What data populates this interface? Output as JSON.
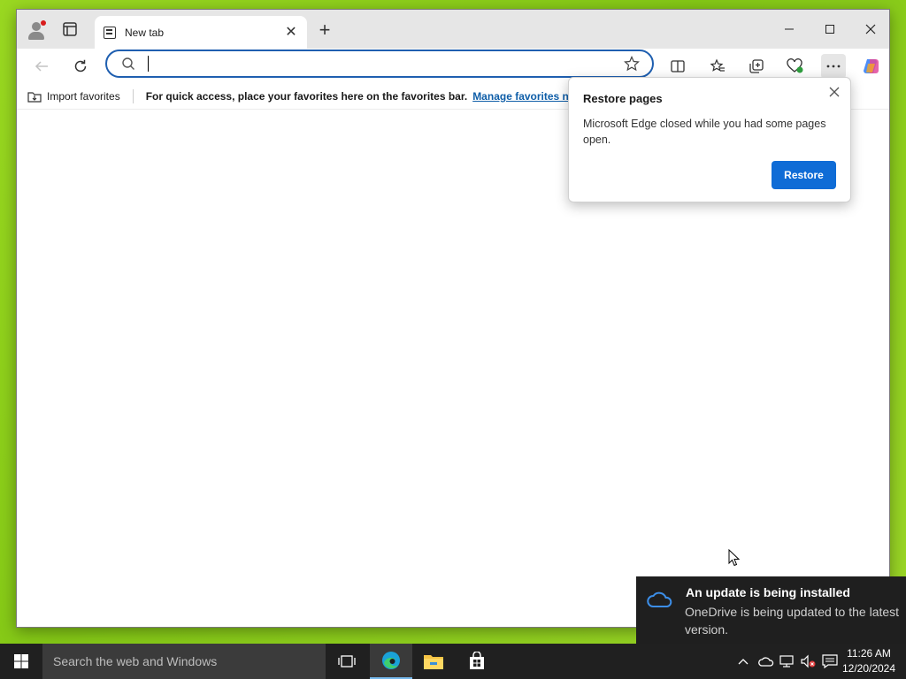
{
  "browser": {
    "tab": {
      "title": "New tab",
      "close_glyph": "✕"
    },
    "new_tab_glyph": "+",
    "address": {
      "value": "",
      "placeholder": ""
    },
    "favorites_bar": {
      "import_label": "Import favorites",
      "message": "For quick access, place your favorites here on the favorites bar.",
      "manage_link": "Manage favorites now"
    }
  },
  "popup": {
    "title": "Restore pages",
    "body": "Microsoft Edge closed while you had some pages open.",
    "button": "Restore"
  },
  "toast": {
    "title": "An update is being installed",
    "body": "OneDrive is being updated to the latest version."
  },
  "taskbar": {
    "search_placeholder": "Search the web and Windows",
    "time": "11:26 AM",
    "date": "12/20/2024"
  },
  "colors": {
    "accent": "#0f6cd6",
    "address_border": "#1f5fb0",
    "link": "#0f5ea8",
    "taskbar": "#202020",
    "desktop": "#8fd11a"
  }
}
